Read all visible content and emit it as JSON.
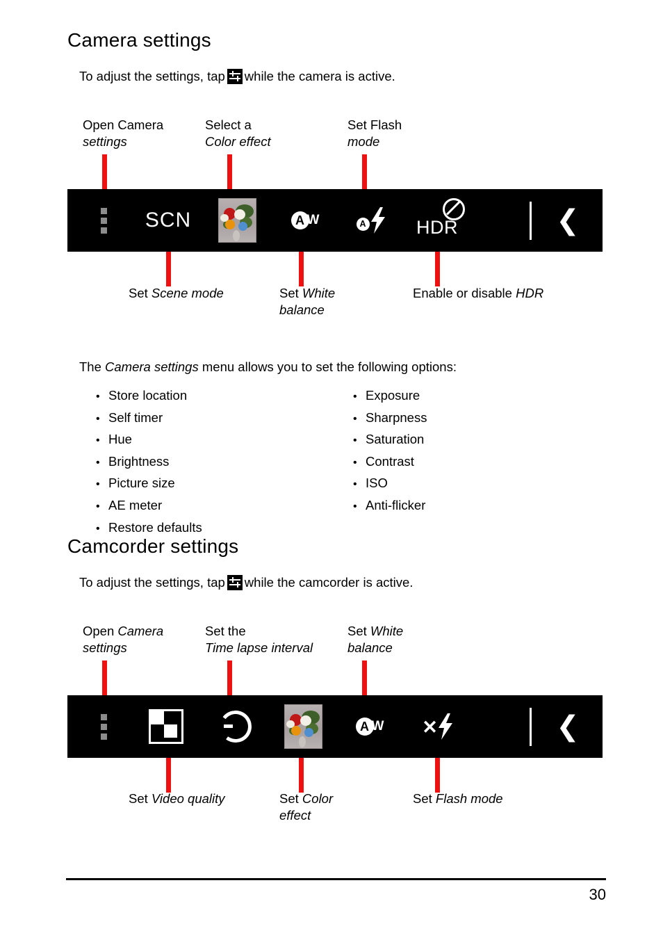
{
  "document": {
    "page_number": "30"
  },
  "sections": [
    {
      "id": "camera",
      "title": "Camera settings",
      "intro_before": "To adjust the settings, tap",
      "intro_after": "while the camera is active.",
      "intro_icon": "settings-sliders-icon",
      "callouts_top": [
        {
          "lines": [
            "Open <em>Camera</em>",
            "<em>settings</em>"
          ],
          "line1": "Open Camera",
          "line2": "settings"
        },
        {
          "lines": [
            "Select a",
            "<em>Color effect</em>"
          ],
          "line1": "Select a",
          "line2": "Color effect"
        },
        {
          "lines": [
            "Set <em>Flash</em>",
            "<em>mode</em>"
          ],
          "line1": "Set Flash",
          "line2": "mode"
        }
      ],
      "callouts_bottom": [
        {
          "line1": "Set Scene mode",
          "line2": ""
        },
        {
          "line1": "Set White",
          "line2": "balance"
        },
        {
          "line1": "Enable or disable HDR",
          "line2": ""
        }
      ],
      "toolbar_icons": [
        {
          "name": "overflow-menu-icon",
          "label": "SCN"
        }
      ],
      "scn_label": "SCN",
      "hdr_label": "HDR",
      "aw_a": "A",
      "aw_w": "W",
      "flash_a": "A",
      "flash_x": "✕",
      "back_chevron": "❮"
    },
    {
      "id": "camcorder",
      "title": "Camcorder settings",
      "intro_before": "To adjust the settings, tap",
      "intro_after": "while the camcorder is active.",
      "intro_icon": "settings-sliders-icon",
      "callouts_top": [
        {
          "line1": "Open Camera",
          "line2": "settings"
        },
        {
          "line1": "Set the",
          "line2": "Time lapse interval"
        },
        {
          "line1": "Set White",
          "line2": "balance"
        }
      ],
      "callouts_bottom": [
        {
          "line1": "Set Video quality",
          "line2": ""
        },
        {
          "line1": "Set Color",
          "line2": "effect"
        },
        {
          "line1": "Set Flash mode",
          "line2": ""
        }
      ],
      "aw_a": "A",
      "aw_w": "W",
      "flash_x": "✕",
      "back_chevron": "❮"
    }
  ],
  "options_intro": {
    "before": "The",
    "emphasis": "Camera settings",
    "after": "menu allows you to set the following options:"
  },
  "options_left": [
    "Store location",
    "Self timer",
    "Hue",
    "Brightness",
    "Picture size",
    "AE meter",
    "Restore defaults"
  ],
  "options_right": [
    "Exposure",
    "Sharpness",
    "Saturation",
    "Contrast",
    "ISO",
    "Anti-flicker"
  ],
  "bullet_glyph": "•",
  "colors": {
    "leader_red": "#ee1111",
    "toolbar_bg": "#000000",
    "page_bg": "#ffffff",
    "dot_gray": "#8c8c8c"
  }
}
